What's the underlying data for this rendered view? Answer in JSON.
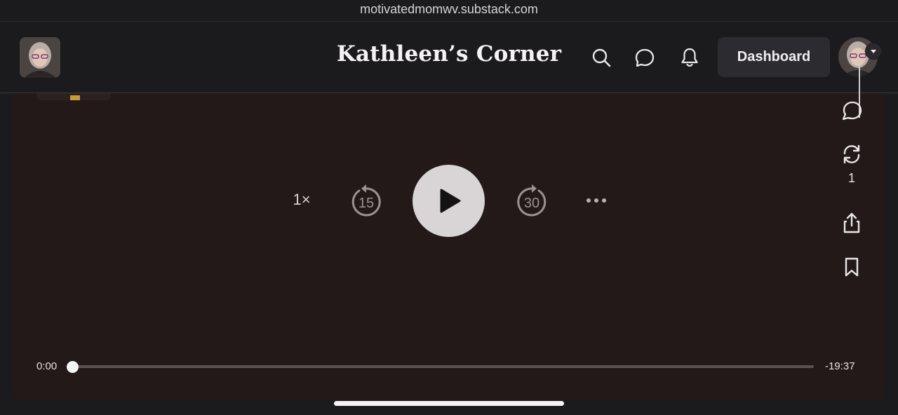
{
  "browser": {
    "url": "motivatedmomwv.substack.com"
  },
  "header": {
    "publication_title": "Kathleen’s Corner",
    "dashboard_label": "Dashboard",
    "icons": [
      "search-icon",
      "chat-icon",
      "bell-icon"
    ]
  },
  "player": {
    "speed_label": "1×",
    "skip_back_seconds": "15",
    "skip_forward_seconds": "30",
    "current_time": "0:00",
    "remaining_time": "-19:37",
    "progress": 0
  },
  "side_actions": {
    "restack_count": "1",
    "icons": [
      "comment-icon",
      "restack-icon",
      "share-icon",
      "bookmark-icon"
    ]
  },
  "colors": {
    "background": "#1b1a1d",
    "player_background": "#221918",
    "play_button": "#d9d5d6"
  }
}
